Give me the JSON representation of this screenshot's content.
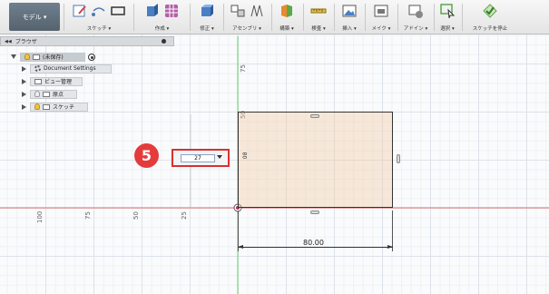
{
  "toolbar": {
    "model_label": "モデル ▾",
    "groups": [
      "スケッチ ▾",
      "作成 ▾",
      "修正 ▾",
      "アセンブリ ▾",
      "構築 ▾",
      "検査 ▾",
      "挿入 ▾",
      "メイク ▾",
      "アドイン ▾",
      "選択 ▾",
      "スケッチを停止"
    ]
  },
  "browser": {
    "title": "ブラウザ",
    "root_label": "(未保存)",
    "items": [
      "Document Settings",
      "ビュー管理",
      "原点",
      "スケッチ"
    ]
  },
  "axes": {
    "x_ticks": [
      "100",
      "75",
      "50",
      "25"
    ],
    "y_ticks": [
      "75",
      "50"
    ]
  },
  "input": {
    "value": "27",
    "step_number": "5",
    "inline_label": "80"
  },
  "dimension": {
    "value": "80.00"
  },
  "colors": {
    "accent": "#e53b3b",
    "axis_red": "#e36b6b",
    "axis_green": "#6bd06b",
    "shape_fill": "#f5e6d8"
  }
}
